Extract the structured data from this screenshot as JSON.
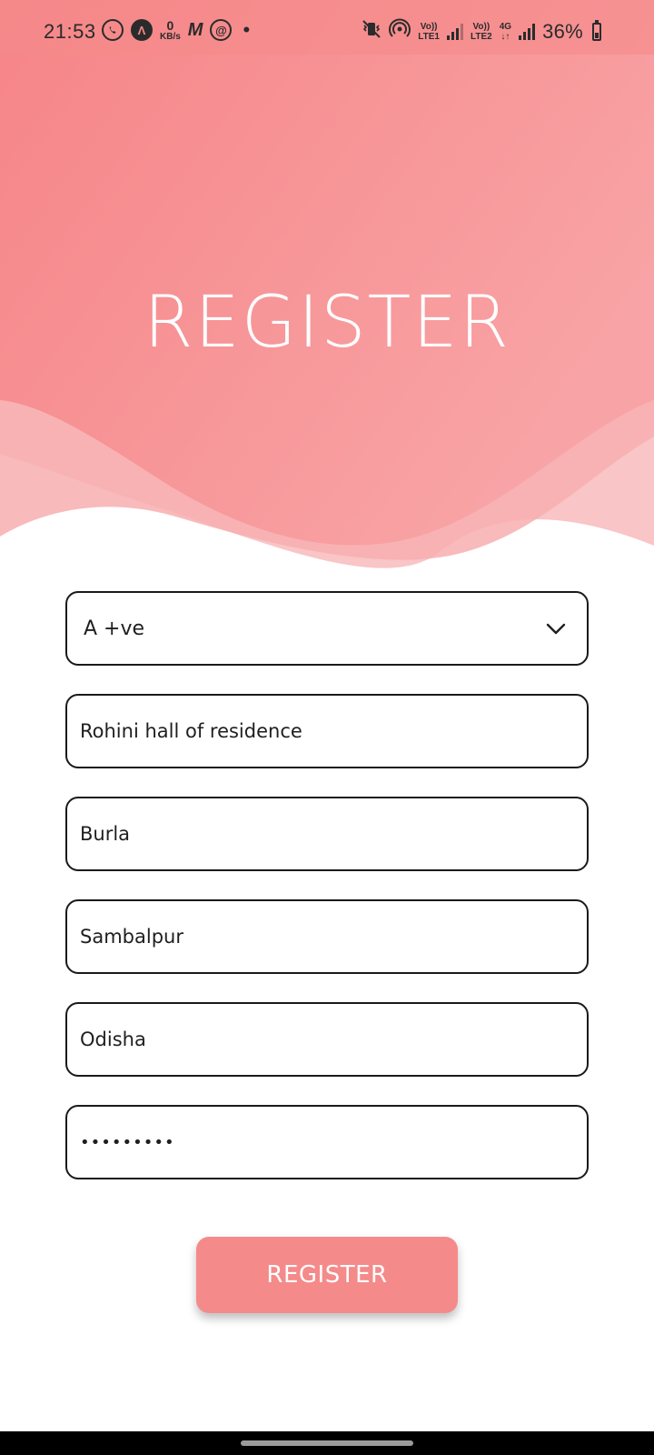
{
  "colors": {
    "accent": "#f58a8a",
    "wave_light": "#f9c5c7",
    "title_text": "#ffffff",
    "field_border": "#1a1a1a"
  },
  "status_bar": {
    "time": "21:53",
    "left_icons": [
      "whatsapp-icon",
      "app-a-icon",
      "data-speed-icon",
      "m-app-icon",
      "at-app-icon",
      "dot-icon"
    ],
    "data_speed_value": "0",
    "data_speed_unit": "KB/s",
    "m_icon_glyph": "M",
    "at_icon_glyph": "@",
    "a_icon_glyph": "Λ",
    "sim1_top": "Vo))",
    "sim1_bottom": "LTE1",
    "sim2_top": "Vo))",
    "sim2_bottom": "LTE2",
    "network_type": "4G",
    "network_arrows": "↓↑",
    "battery_percent": "36%",
    "right_icons": [
      "vibrate-mute-icon",
      "hotspot-icon",
      "signal-icon",
      "battery-icon"
    ]
  },
  "header": {
    "title": "REGISTER"
  },
  "form": {
    "blood_group": {
      "selected": "A +ve"
    },
    "address": "Rohini hall of residence",
    "city": "Burla",
    "district": "Sambalpur",
    "state": "Odisha",
    "password_masked": "•••••••••"
  },
  "submit": {
    "label": "REGISTER"
  }
}
